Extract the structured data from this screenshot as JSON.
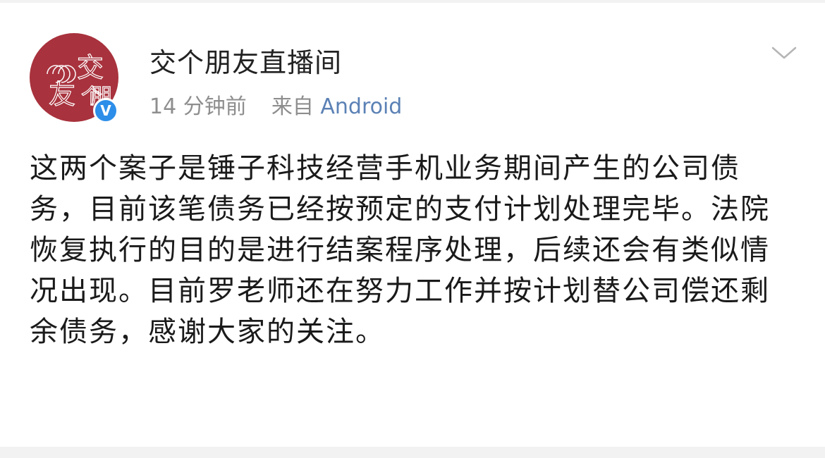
{
  "post": {
    "author": "交个朋友直播间",
    "avatar_text": [
      "交",
      "个",
      "朋",
      "友"
    ],
    "time": "14 分钟前",
    "from_label": "来自",
    "source": "Android",
    "verified_mark": "V",
    "body": "这两个案子是锤子科技经营手机业务期间产生的公司债务，目前该笔债务已经按预定的支付计划处理完毕。法院恢复执行的目的是进行结案程序处理，后续还会有类似情况出现。目前罗老师还在努力工作并按计划替公司偿还剩余债务，感谢大家的关注。"
  },
  "colors": {
    "avatar_bg": "#a8323d",
    "verified_badge": "#2d8ee9",
    "source_link": "#5b81b5"
  }
}
